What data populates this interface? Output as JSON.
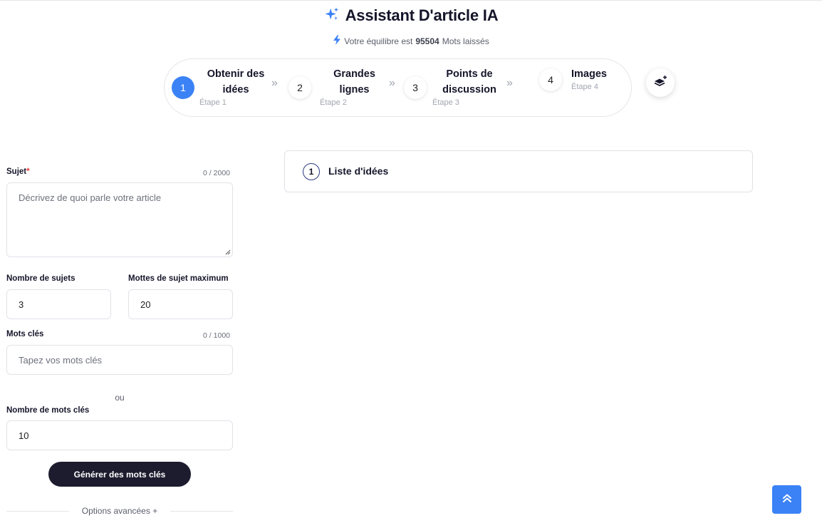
{
  "header": {
    "title": "Assistant D'article IA",
    "balance_prefix": "Votre équilibre est",
    "balance_value": "95504",
    "balance_suffix": "Mots laissés",
    "sparkle_icon": "sparkles-icon",
    "bolt_icon": "bolt-icon"
  },
  "stepper": {
    "steps": [
      {
        "number": "1",
        "title_line1": "Obtenir des",
        "title_line2": "idées",
        "subtitle": "Étape 1",
        "active": true
      },
      {
        "number": "2",
        "title_line1": "Grandes",
        "title_line2": "lignes",
        "subtitle": "Étape 2",
        "active": false
      },
      {
        "number": "3",
        "title_line1": "Points de",
        "title_line2": "discussion",
        "subtitle": "Étape 3",
        "active": false
      },
      {
        "number": "4",
        "title_line1": "Images",
        "title_line2": "",
        "subtitle": "Étape 4",
        "active": false
      }
    ],
    "separator_icon": "double-chevron-right-icon",
    "layers_icon": "layers-plus-icon"
  },
  "form": {
    "subject": {
      "label": "Sujet",
      "required_mark": "*",
      "counter": "0 / 2000",
      "placeholder": "Décrivez de quoi parle votre article"
    },
    "topic_count": {
      "label": "Nombre de sujets",
      "value": "3"
    },
    "max_topic_words": {
      "label": "Mottes de sujet maximum",
      "value": "20"
    },
    "keywords": {
      "label": "Mots clés",
      "counter": "0 / 1000",
      "placeholder": "Tapez vos mots clés"
    },
    "or_text": "ou",
    "keyword_count": {
      "label": "Nombre de mots clés",
      "value": "10"
    },
    "generate_button": "Générer des mots clés",
    "advanced_options": "Options avancées +"
  },
  "ideas_panel": {
    "number": "1",
    "title": "Liste d'idées"
  },
  "scroll_top_icon": "double-chevron-up-icon",
  "colors": {
    "accent": "#3b82f6",
    "dark_button": "#1d1b2e",
    "required": "#e53935"
  }
}
